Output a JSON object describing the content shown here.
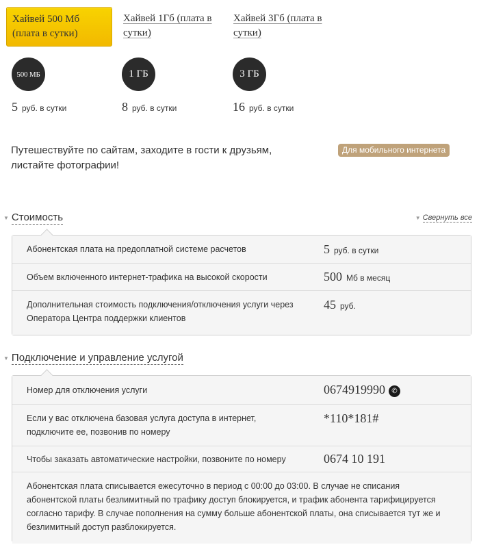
{
  "tabs": [
    {
      "line1": "Хайвей 500 Мб",
      "line2": "(плата в сутки)",
      "active": true
    },
    {
      "line1": "Хайвей 1Гб (плата в",
      "line2": "сутки)",
      "active": false
    },
    {
      "line1": "Хайвей 3Гб (плата в",
      "line2": "сутки)",
      "active": false
    }
  ],
  "plans": [
    {
      "badge": "500 МБ",
      "price": "5",
      "unit": "руб. в сутки"
    },
    {
      "badge": "1 ГБ",
      "price": "8",
      "unit": "руб. в сутки"
    },
    {
      "badge": "3 ГБ",
      "price": "16",
      "unit": "руб. в сутки"
    }
  ],
  "description": {
    "line1": "Путешествуйте по сайтам, заходите в гости к друзьям,",
    "line2": "листайте фотографии!"
  },
  "category_badge": "Для мобильного интернета",
  "cost_section": {
    "title": "Стоимость",
    "collapse_all": "Свернуть все",
    "rows": [
      {
        "label": "Абонентская плата на предоплатной системе расчетов",
        "value": "5",
        "unit": "руб. в сутки"
      },
      {
        "label": "Объем включенного интернет-трафика на высокой скорости",
        "value": "500",
        "unit": "Мб в месяц"
      },
      {
        "label_line1": "Дополнительная стоимость подключения/отключения услуги через",
        "label_line2": "Оператора Центра поддержки клиентов",
        "value": "45",
        "unit": "руб."
      }
    ]
  },
  "connect_section": {
    "title": "Подключение и управление услугой",
    "rows": [
      {
        "label": "Номер для отключения услуги",
        "value": "0674919990",
        "icon": "phone-icon"
      },
      {
        "label_line1": "Если у вас отключена базовая услуга доступа в интернет,",
        "label_line2": "подключите ее, позвонив по номеру",
        "value": "*110*181#"
      },
      {
        "label": "Чтобы заказать автоматические настройки, позвоните по номеру",
        "value": "0674 10 191"
      }
    ],
    "note": {
      "line1": "Абонентская плата списывается ежесуточно в период с 00:00 до 03:00. В случае не списания",
      "line2": "абонентской платы безлимитный по трафику доступ блокируется, и трафик абонента тарифицируется",
      "line3": "согласно тарифу. В случае пополнения на сумму больше абонентской платы, она списывается тут же и",
      "line4": "безлимитный доступ разблокируется."
    }
  },
  "colors": {
    "active_tab": "#f5c400",
    "badge_bg": "#bfa27a",
    "circle_bg": "#2b2b2b",
    "panel_bg": "#f5f5f5"
  }
}
